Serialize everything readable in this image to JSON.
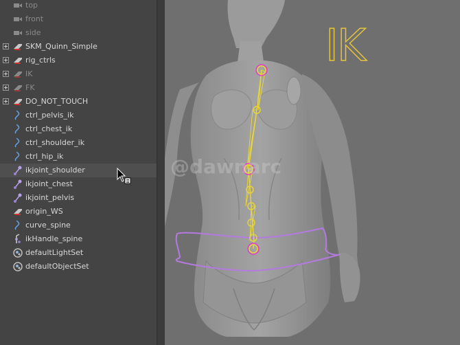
{
  "outliner": {
    "items": [
      {
        "label": "top",
        "icon": "camera-icon",
        "dim": true
      },
      {
        "label": "front",
        "icon": "camera-icon",
        "dim": true
      },
      {
        "label": "side",
        "icon": "camera-icon",
        "dim": true
      },
      {
        "label": "SKM_Quinn_Simple",
        "icon": "group-icon",
        "expandable": true
      },
      {
        "label": "rig_ctrls",
        "icon": "group-icon",
        "expandable": true
      },
      {
        "label": "IK",
        "icon": "group-icon",
        "expandable": true,
        "dim": true
      },
      {
        "label": "FK",
        "icon": "group-icon",
        "expandable": true,
        "dim": true
      },
      {
        "label": "DO_NOT_TOUCH",
        "icon": "group-icon",
        "expandable": true
      },
      {
        "label": "ctrl_pelvis_ik",
        "icon": "curve-icon"
      },
      {
        "label": "ctrl_chest_ik",
        "icon": "curve-icon"
      },
      {
        "label": "ctrl_shoulder_ik",
        "icon": "curve-icon"
      },
      {
        "label": "ctrl_hip_ik",
        "icon": "curve-icon"
      },
      {
        "label": "ikjoint_shoulder",
        "icon": "joint-icon",
        "hover": true
      },
      {
        "label": "ikjoint_chest",
        "icon": "joint-icon"
      },
      {
        "label": "ikjoint_pelvis",
        "icon": "joint-icon"
      },
      {
        "label": "origin_WS",
        "icon": "group-icon"
      },
      {
        "label": "curve_spine",
        "icon": "curve-icon"
      },
      {
        "label": "ikHandle_spine",
        "icon": "ik-handle-icon"
      },
      {
        "label": "defaultLightSet",
        "icon": "set-icon"
      },
      {
        "label": "defaultObjectSet",
        "icon": "set-icon"
      }
    ]
  },
  "viewport": {
    "overlay_text": "IK",
    "watermark": "@dawnarc"
  },
  "colors": {
    "panel_bg": "#444444",
    "viewport_bg": "#6f6f6f",
    "skeleton": "#e6d43a",
    "control_curve": "#b47ae0",
    "joint_highlight": "#e040c8",
    "ik_label": "#e6c43a"
  }
}
